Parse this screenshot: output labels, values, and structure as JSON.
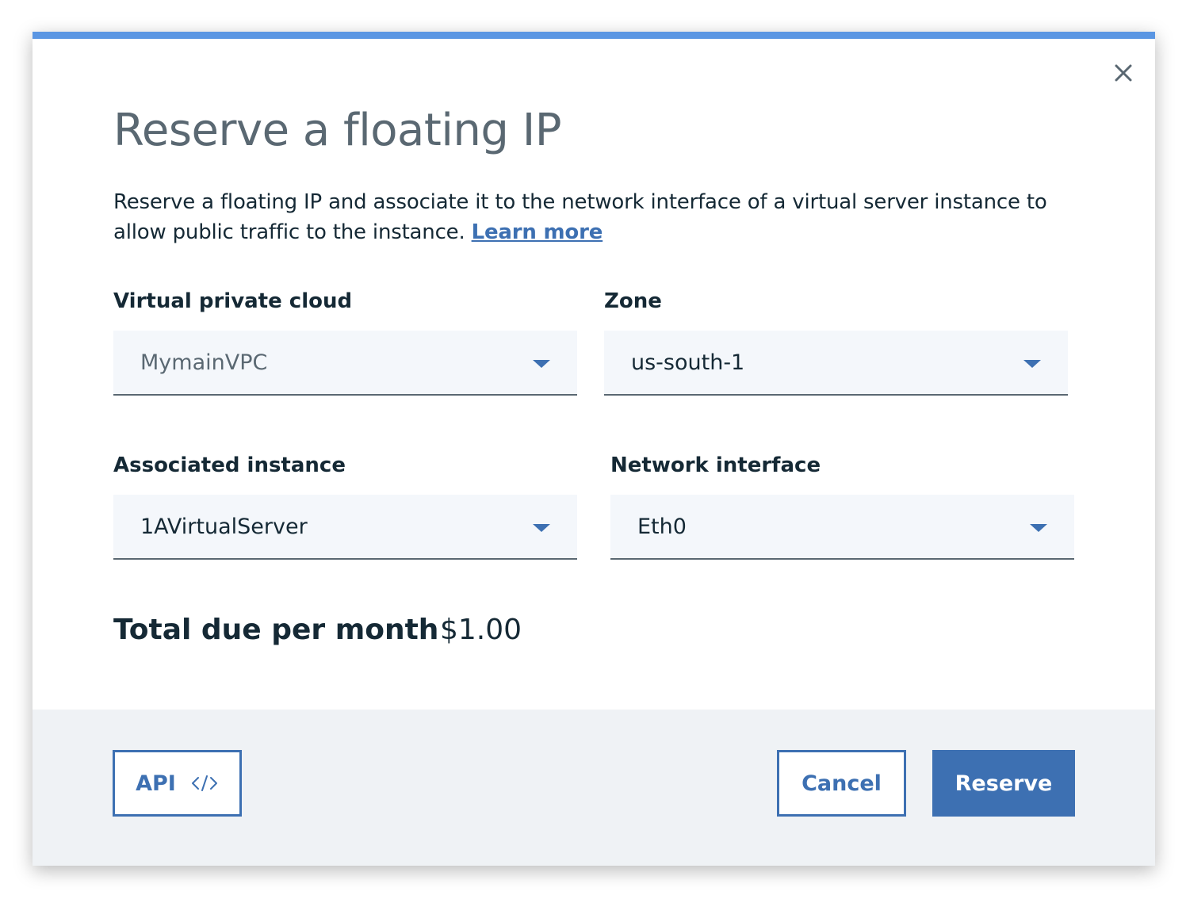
{
  "modal": {
    "title": "Reserve a floating IP",
    "description": "Reserve a floating IP and associate it to the network interface of a virtual server instance to allow public traffic to the instance.",
    "learn_more_label": "Learn more",
    "accent_color": "#5a96e3",
    "close_icon": "close-icon"
  },
  "fields": {
    "vpc": {
      "label": "Virtual private cloud",
      "value": "MymainVPC"
    },
    "zone": {
      "label": "Zone",
      "value": "us-south-1"
    },
    "instance": {
      "label": "Associated instance",
      "value": "1AVirtualServer"
    },
    "interface": {
      "label": "Network interface",
      "value": "Eth0"
    }
  },
  "total": {
    "label": "Total due per month",
    "value": "$1.00"
  },
  "footer": {
    "api_label": "API",
    "api_icon": "code-icon",
    "cancel_label": "Cancel",
    "reserve_label": "Reserve",
    "primary_color": "#3d70b2"
  }
}
